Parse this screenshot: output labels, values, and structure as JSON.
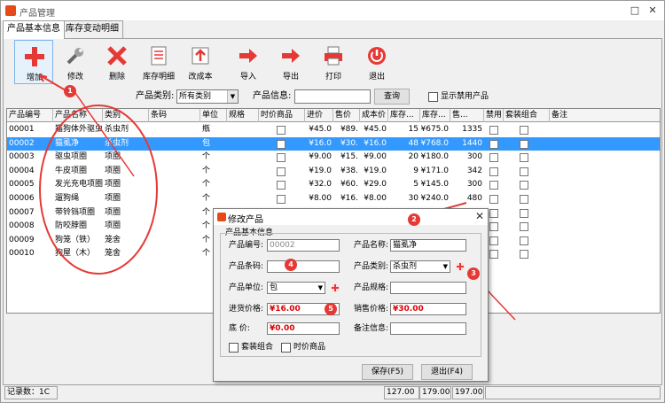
{
  "window": {
    "title": "产品管理"
  },
  "tabs": [
    {
      "label": "产品基本信息",
      "active": true
    },
    {
      "label": "库存变动明细",
      "active": false
    }
  ],
  "toolbar": [
    {
      "label": "增加",
      "icon": "plus-icon"
    },
    {
      "label": "修改",
      "icon": "wrench-icon"
    },
    {
      "label": "删除",
      "icon": "delete-x-icon"
    },
    {
      "label": "库存明细",
      "icon": "list-document-icon"
    },
    {
      "label": "改成本",
      "icon": "cost-edit-icon"
    },
    {
      "label": "导入",
      "icon": "import-arrow-icon"
    },
    {
      "label": "导出",
      "icon": "export-arrow-icon"
    },
    {
      "label": "打印",
      "icon": "printer-icon"
    },
    {
      "label": "退出",
      "icon": "exit-icon"
    }
  ],
  "filter": {
    "category_label": "产品类别:",
    "category_value": "所有类别",
    "info_label": "产品信息:",
    "info_value": "",
    "search_label": "查询",
    "show_disabled_label": "显示禁用产品"
  },
  "table": {
    "columns": [
      "产品编号",
      "产品名称",
      "类别",
      "条码",
      "单位",
      "规格",
      "时价商品",
      "进价",
      "售价",
      "成本价",
      "库存...",
      "库存...",
      "售...",
      "禁用",
      "套装组合",
      "备注"
    ],
    "rows": [
      {
        "id": "00001",
        "name": "猫狗体外驱虫",
        "category": "杀虫剂",
        "barcode": "",
        "unit": "瓶",
        "spec": "",
        "purchase": "¥45.0",
        "sale": "¥89.",
        "cost": "¥45.0",
        "stock": "15",
        "stock_amount": "¥675.0",
        "sold": "1335"
      },
      {
        "id": "00002",
        "name": "猫虱净",
        "category": "杀虫剂",
        "barcode": "",
        "unit": "包",
        "spec": "",
        "purchase": "¥16.0",
        "sale": "¥30.",
        "cost": "¥16.0",
        "stock": "48",
        "stock_amount": "¥768.0",
        "sold": "1440"
      },
      {
        "id": "00003",
        "name": "驱虫项圈",
        "category": "项圈",
        "barcode": "",
        "unit": "个",
        "spec": "",
        "purchase": "¥9.00",
        "sale": "¥15.",
        "cost": "¥9.00",
        "stock": "20",
        "stock_amount": "¥180.0",
        "sold": "300"
      },
      {
        "id": "00004",
        "name": "牛皮项圈",
        "category": "项圈",
        "barcode": "",
        "unit": "个",
        "spec": "",
        "purchase": "¥19.0",
        "sale": "¥38.",
        "cost": "¥19.0",
        "stock": "9",
        "stock_amount": "¥171.0",
        "sold": "342"
      },
      {
        "id": "00005",
        "name": "发光充电项圈",
        "category": "项圈",
        "barcode": "",
        "unit": "个",
        "spec": "",
        "purchase": "¥32.0",
        "sale": "¥60.",
        "cost": "¥29.0",
        "stock": "5",
        "stock_amount": "¥145.0",
        "sold": "300"
      },
      {
        "id": "00006",
        "name": "遛狗绳",
        "category": "项圈",
        "barcode": "",
        "unit": "个",
        "spec": "",
        "purchase": "¥8.00",
        "sale": "¥16.",
        "cost": "¥8.00",
        "stock": "30",
        "stock_amount": "¥240.0",
        "sold": "480"
      },
      {
        "id": "00007",
        "name": "带铃铛项圈",
        "category": "项圈",
        "barcode": "",
        "unit": "个",
        "spec": "",
        "purchase": "",
        "sale": "",
        "cost": "",
        "stock": "",
        "stock_amount": "",
        "sold": ""
      },
      {
        "id": "00008",
        "name": "防咬脖圈",
        "category": "项圈",
        "barcode": "",
        "unit": "个",
        "spec": "",
        "purchase": "",
        "sale": "",
        "cost": "",
        "stock": "",
        "stock_amount": "",
        "sold": ""
      },
      {
        "id": "00009",
        "name": "狗笼（铁）",
        "category": "笼舍",
        "barcode": "",
        "unit": "个",
        "spec": "",
        "purchase": "",
        "sale": "",
        "cost": "",
        "stock": "",
        "stock_amount": "",
        "sold": ""
      },
      {
        "id": "00010",
        "name": "狗屋（木）",
        "category": "笼舍",
        "barcode": "",
        "unit": "个",
        "spec": "",
        "purchase": "",
        "sale": "",
        "cost": "",
        "stock": "",
        "stock_amount": "",
        "sold": ""
      }
    ]
  },
  "status": {
    "record_label": "记录数：1C",
    "v1": "127.00",
    "v2": "179.00",
    "v3": "197.00"
  },
  "dialog": {
    "title": "修改产品",
    "group_title": "产品基本信息",
    "code_label": "产品编号:",
    "code_value": "00002",
    "name_label": "产品名称:",
    "name_value": "猫虱净",
    "barcode_label": "产品条码:",
    "barcode_value": "",
    "category_label": "产品类别:",
    "category_value": "杀虫剂",
    "unit_label": "产品单位:",
    "unit_value": "包",
    "spec_label": "产品规格:",
    "spec_value": "",
    "purchase_label": "进货价格:",
    "purchase_value": "¥16.00",
    "sale_label": "销售价格:",
    "sale_value": "¥30.00",
    "base_label": "底  价:",
    "base_value": "¥0.00",
    "note_label": "备注信息:",
    "note_value": "",
    "set_label": "套装组合",
    "timeprice_label": "时价商品",
    "save_label": "保存(F5)",
    "exit_label": "退出(F4)"
  },
  "annotations": [
    "1",
    "2",
    "3",
    "4",
    "5"
  ],
  "colors": {
    "selection": "#3399ff",
    "annotation": "#e53935",
    "price_red": "#e00000"
  }
}
